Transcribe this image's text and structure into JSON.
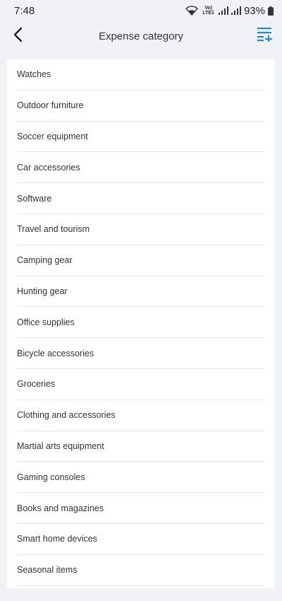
{
  "status_bar": {
    "time": "7:48",
    "network_top": "Vo)",
    "network_bottom": "LTE1",
    "battery": "93%"
  },
  "header": {
    "title": "Expense category",
    "accent_color": "#1e88e5"
  },
  "categories": [
    "Watches",
    "Outdoor furniture",
    "Soccer equipment",
    "Car accessories",
    "Software",
    "Travel and tourism",
    "Camping gear",
    "Hunting gear",
    "Office supplies",
    "Bicycle accessories",
    "Groceries",
    "Clothing and accessories",
    "Martial arts equipment",
    "Gaming consoles",
    "Books and magazines",
    "Smart home devices",
    "Seasonal items"
  ],
  "icons": {
    "back": "back-arrow-icon",
    "add_list": "playlist-add-icon",
    "wifi": "wifi-icon",
    "signal": "signal-icon",
    "battery": "battery-icon"
  }
}
